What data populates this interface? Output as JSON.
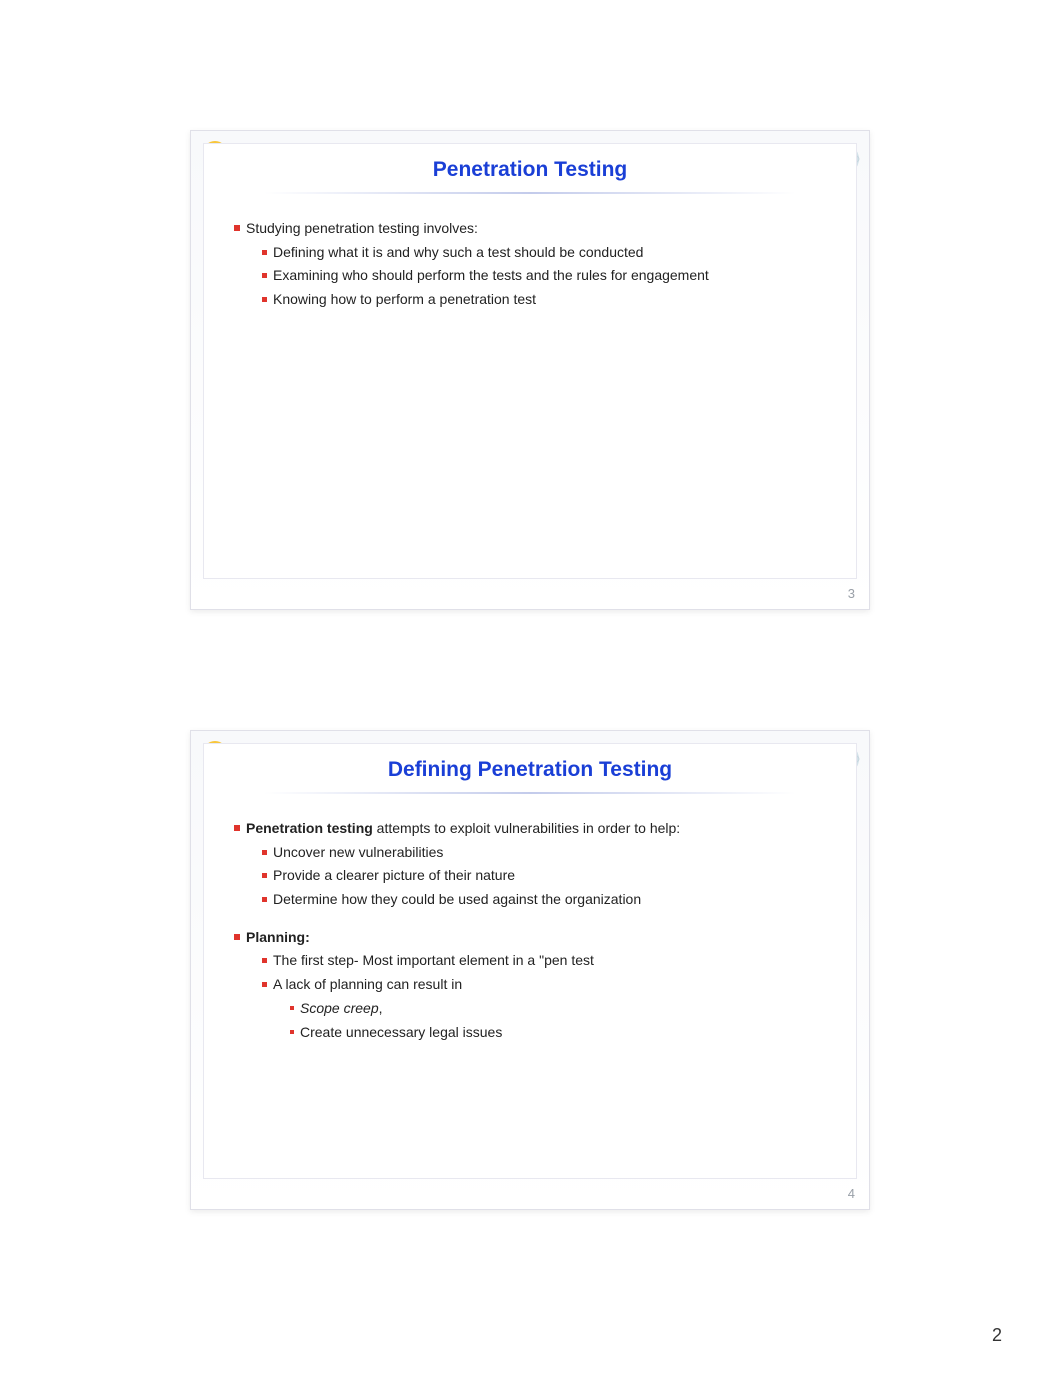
{
  "page_number": "2",
  "slide1": {
    "number": "3",
    "title": "Penetration Testing",
    "intro": "Studying penetration testing involves:",
    "points": [
      "Defining what it is and why such a test should be conducted",
      "Examining who should perform the tests and the rules for engagement",
      "Knowing how to perform a penetration test"
    ]
  },
  "slide2": {
    "number": "4",
    "title": "Defining Penetration Testing",
    "intro_bold": "Penetration testing",
    "intro_rest": " attempts to exploit vulnerabilities in order to help:",
    "points1": [
      "Uncover new vulnerabilities",
      "Provide a clearer picture of their nature",
      "Determine how they could be used against the organization"
    ],
    "planning_label": "Planning:",
    "planning_p1": "The first step- Most important element in a \"pen test",
    "planning_p2_lead": " A lack of planning can result in",
    "planning_sub_italic": "Scope creep",
    "planning_sub_comma": ",",
    "planning_sub2": "Create unnecessary legal issues"
  }
}
